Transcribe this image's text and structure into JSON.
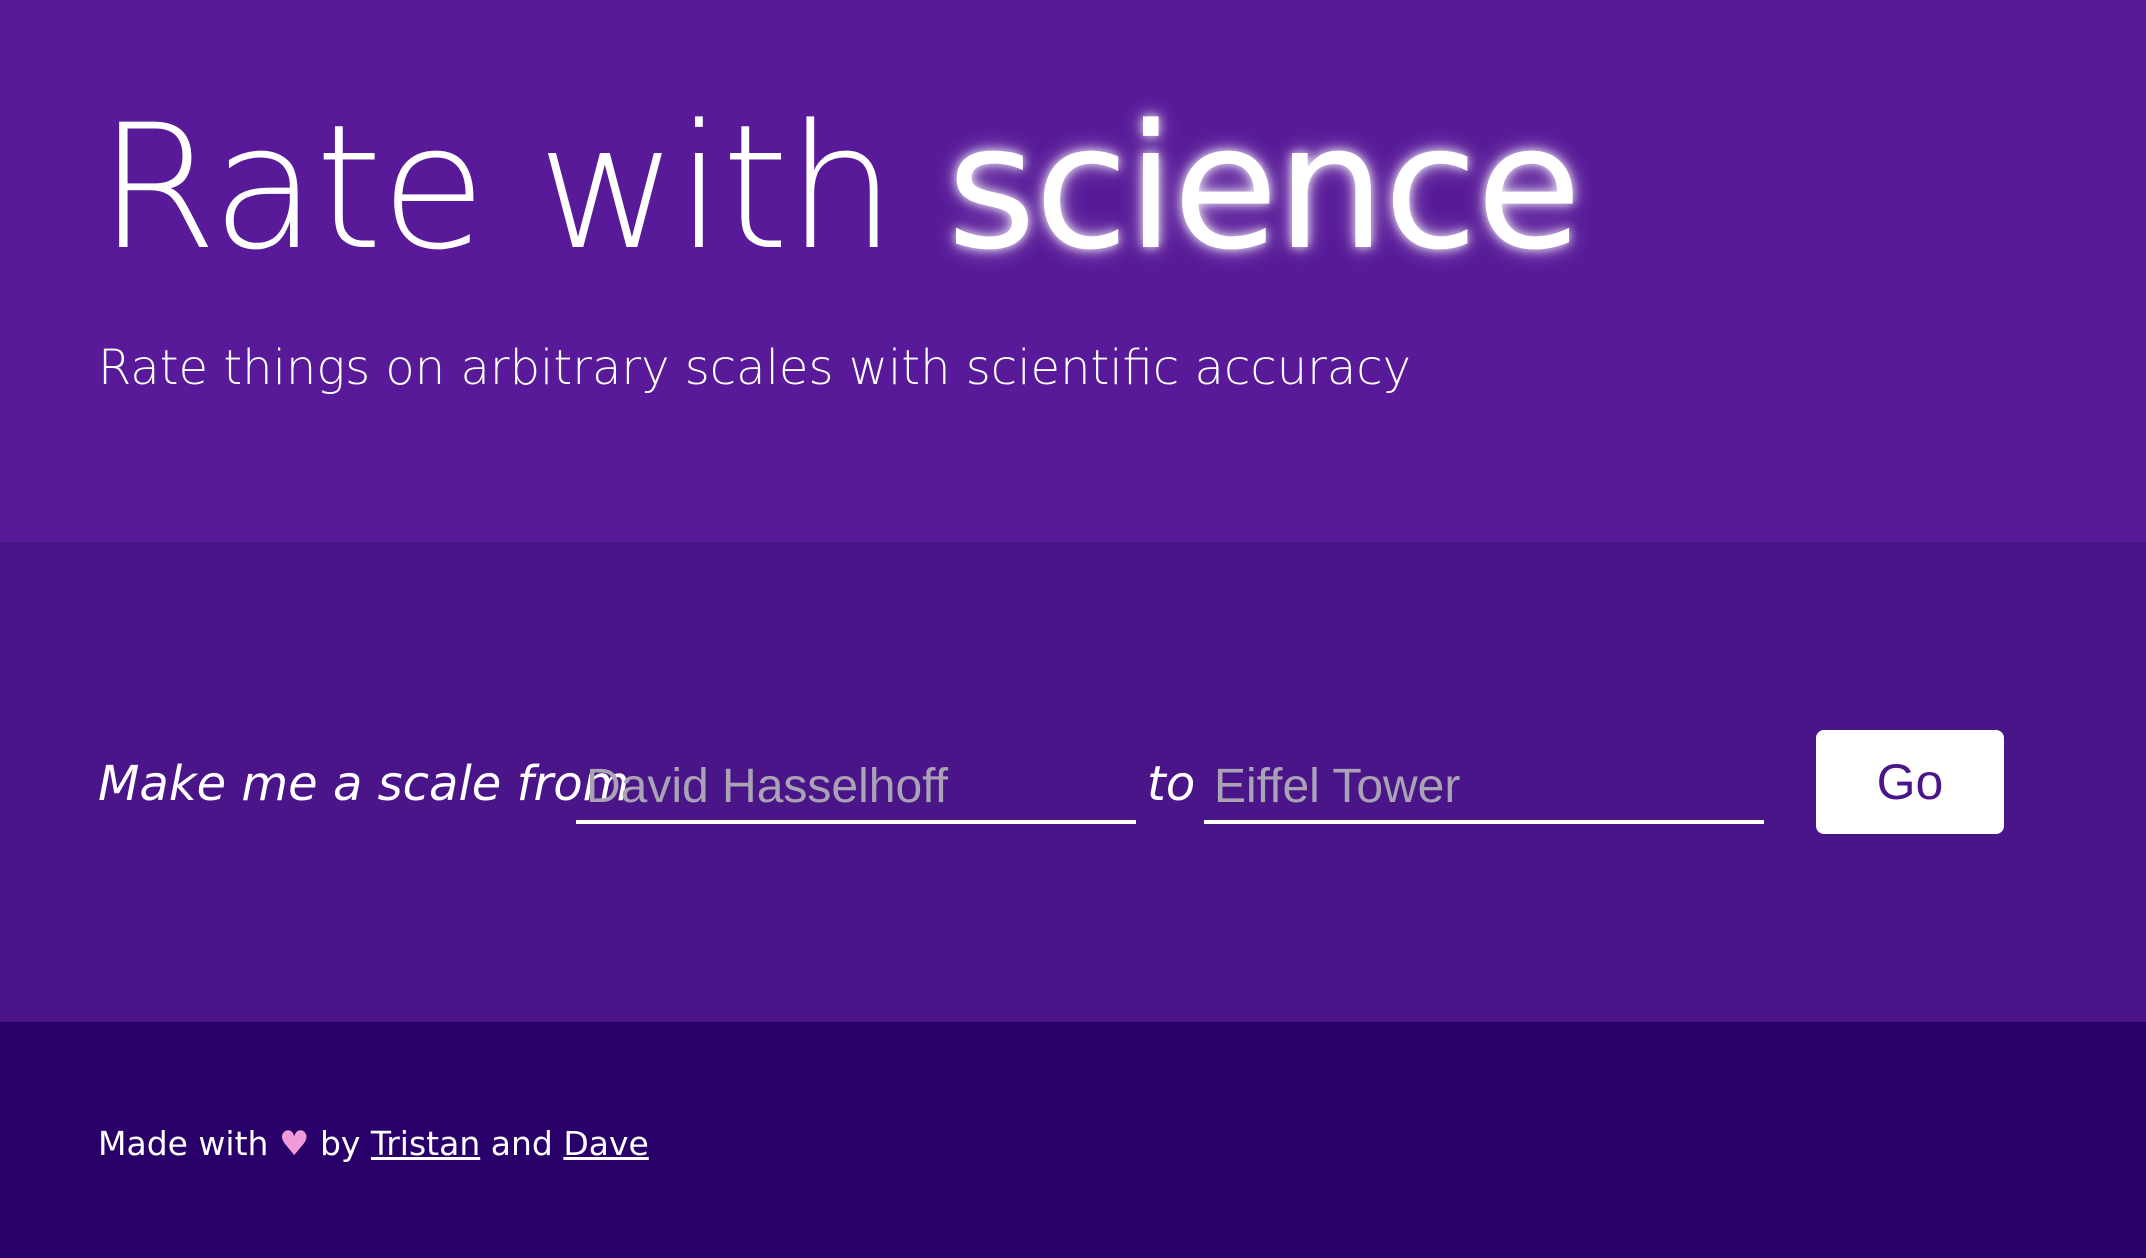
{
  "hero": {
    "title_light": "Rate with",
    "title_glow": "science",
    "subtitle": "Rate things on arbitrary scales with scientific accuracy"
  },
  "form": {
    "lead_text": "Make me a scale from",
    "from_placeholder": "David Hasselhoff",
    "to_text": "to",
    "to_placeholder": "Eiffel Tower",
    "go_label": "Go"
  },
  "footer": {
    "made_with": "Made with",
    "heart": "♥",
    "by": "by",
    "author1": "Tristan",
    "and": "and",
    "author2": "Dave"
  },
  "colors": {
    "hero_bg": "#581a99",
    "form_bg": "#4a1589",
    "footer_bg": "#29006a",
    "heart": "#f09ad8"
  }
}
